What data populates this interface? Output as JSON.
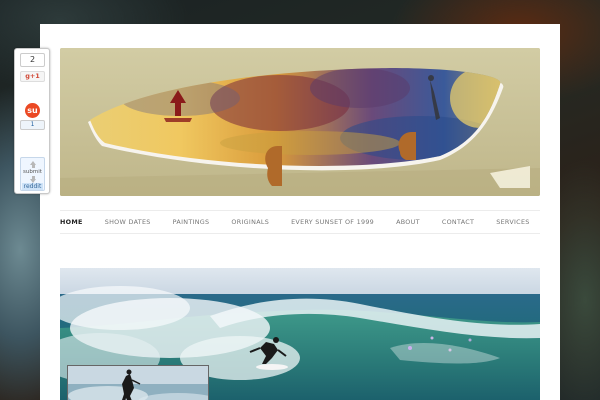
{
  "nav": {
    "items": [
      {
        "label": "HOME",
        "active": true
      },
      {
        "label": "SHOW DATES",
        "active": false
      },
      {
        "label": "PAINTINGS",
        "active": false
      },
      {
        "label": "ORIGINALS",
        "active": false
      },
      {
        "label": "EVERY SUNSET OF 1999",
        "active": false
      },
      {
        "label": "ABOUT",
        "active": false
      },
      {
        "label": "CONTACT",
        "active": false
      },
      {
        "label": "SERVICES",
        "active": false
      }
    ]
  },
  "share": {
    "count": "2",
    "gplus_label": "g+1",
    "stumble_icon": "su",
    "stumble_count": "1",
    "reddit_submit": "submit",
    "reddit_label": "reddit"
  },
  "hero": {
    "icon": "surfboard-painting-image"
  },
  "photo": {
    "icon": "surfer-wave-photo"
  },
  "colors": {
    "page_bg": "#ffffff",
    "nav_text": "#777777",
    "nav_active": "#222222",
    "stumble": "#eb4924",
    "reddit_blue": "#cee3f8"
  }
}
